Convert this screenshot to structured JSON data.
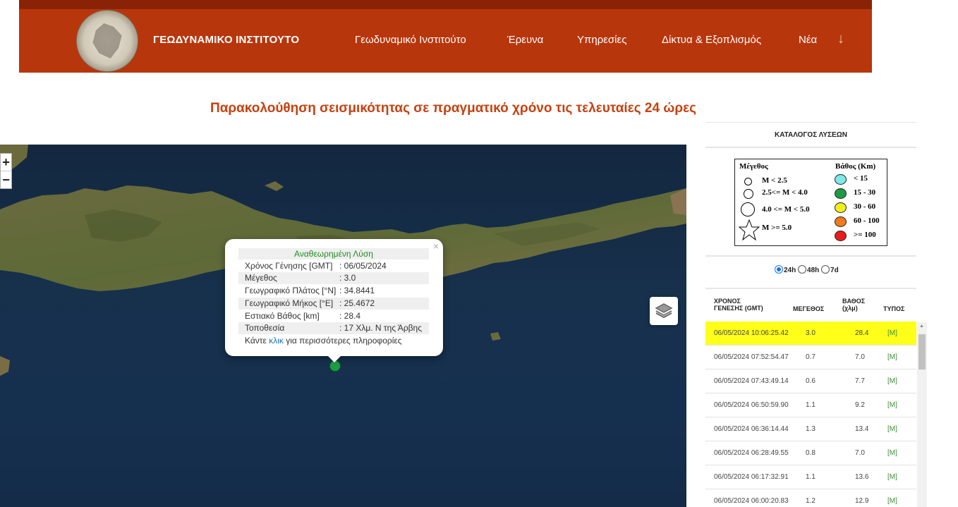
{
  "header": {
    "brand": "ΓΕΩΔΥΝΑΜΙΚΟ ΙΝΣΤΙΤΟΥΤΟ",
    "nav": [
      "Γεωδυναμικό Ινστιτούτο",
      "Έρευνα",
      "Υπηρεσίες",
      "Δίκτυα & Εξοπλισμός",
      "Νέα"
    ],
    "nav_arrow": "↓"
  },
  "page_title": "Παρακολούθηση σεισμικότητας σε πραγματικό χρόνο τις τελευταίες 24 ώρες",
  "map": {
    "zoom_in": "+",
    "zoom_out": "−",
    "popup": {
      "close": "×",
      "header": "Αναθεωρημένη Λύση",
      "rows": [
        {
          "key": "Χρόνος Γένησης [GMT]",
          "value": ": 06/05/2024 10:06:25.42"
        },
        {
          "key": "Μέγεθος",
          "value": ": 3.0"
        },
        {
          "key": "Γεωγραφικό Πλάτος [°N]",
          "value": ": 34.8441"
        },
        {
          "key": "Γεωγραφικό Μήκος [°E]",
          "value": ": 25.4672"
        },
        {
          "key": "Εστιακό Βάθος [km]",
          "value": ": 28.4"
        },
        {
          "key": "Τοποθεσία",
          "value": ": 17 Χλμ. Ν της Άρβης"
        }
      ],
      "footer_pre": "Κάντε ",
      "footer_link": "κλικ",
      "footer_post": " για περισσότερες πληροφορίες"
    },
    "marker_color": "#1f9a44"
  },
  "sidebar": {
    "title": "ΚΑΤΑΛΟΓΟΣ ΛΥΣΕΩΝ",
    "legend": {
      "magnitude_title": "Μέγεθος",
      "magnitudes": [
        "M < 2.5",
        "2.5<= M < 4.0",
        "4.0 <= M < 5.0",
        "M >= 5.0"
      ],
      "depth_title": "Βάθος (Km)",
      "depths": [
        {
          "label": "< 15",
          "color": "#7fe8e8"
        },
        {
          "label": "15 - 30",
          "color": "#1f9a44"
        },
        {
          "label": "30 - 60",
          "color": "#f0ee1c"
        },
        {
          "label": "60 - 100",
          "color": "#f07a1e"
        },
        {
          "label": ">= 100",
          "color": "#e81c1c"
        }
      ]
    },
    "periods": [
      "24h",
      "48h",
      "7d"
    ],
    "columns": {
      "time_1": "ΧΡΟΝΟΣ",
      "time_2": "ΓΕΝΕΣΗΣ (GMT)",
      "magnitude": "ΜΕΓΕΘΟΣ",
      "depth_1": "ΒΑΘΟΣ",
      "depth_2": "(χλμ)",
      "type": "ΤΥΠΟΣ"
    },
    "rows": [
      {
        "time": "06/05/2024 10:06:25.42",
        "mag": "3.0",
        "depth": "28.4",
        "type": "[M]"
      },
      {
        "time": "06/05/2024 07:52:54.47",
        "mag": "0.7",
        "depth": "7.0",
        "type": "[M]"
      },
      {
        "time": "06/05/2024 07:43:49.14",
        "mag": "0.6",
        "depth": "7.7",
        "type": "[M]"
      },
      {
        "time": "06/05/2024 06:50:59.90",
        "mag": "1.1",
        "depth": "9.2",
        "type": "[M]"
      },
      {
        "time": "06/05/2024 06:36:14.44",
        "mag": "1.3",
        "depth": "13.4",
        "type": "[M]"
      },
      {
        "time": "06/05/2024 06:28:49.55",
        "mag": "0.8",
        "depth": "7.0",
        "type": "[M]"
      },
      {
        "time": "06/05/2024 06:17:32.91",
        "mag": "1.1",
        "depth": "13.6",
        "type": "[M]"
      },
      {
        "time": "06/05/2024 06:00:20.83",
        "mag": "1.2",
        "depth": "12.9",
        "type": "[M]"
      }
    ]
  }
}
